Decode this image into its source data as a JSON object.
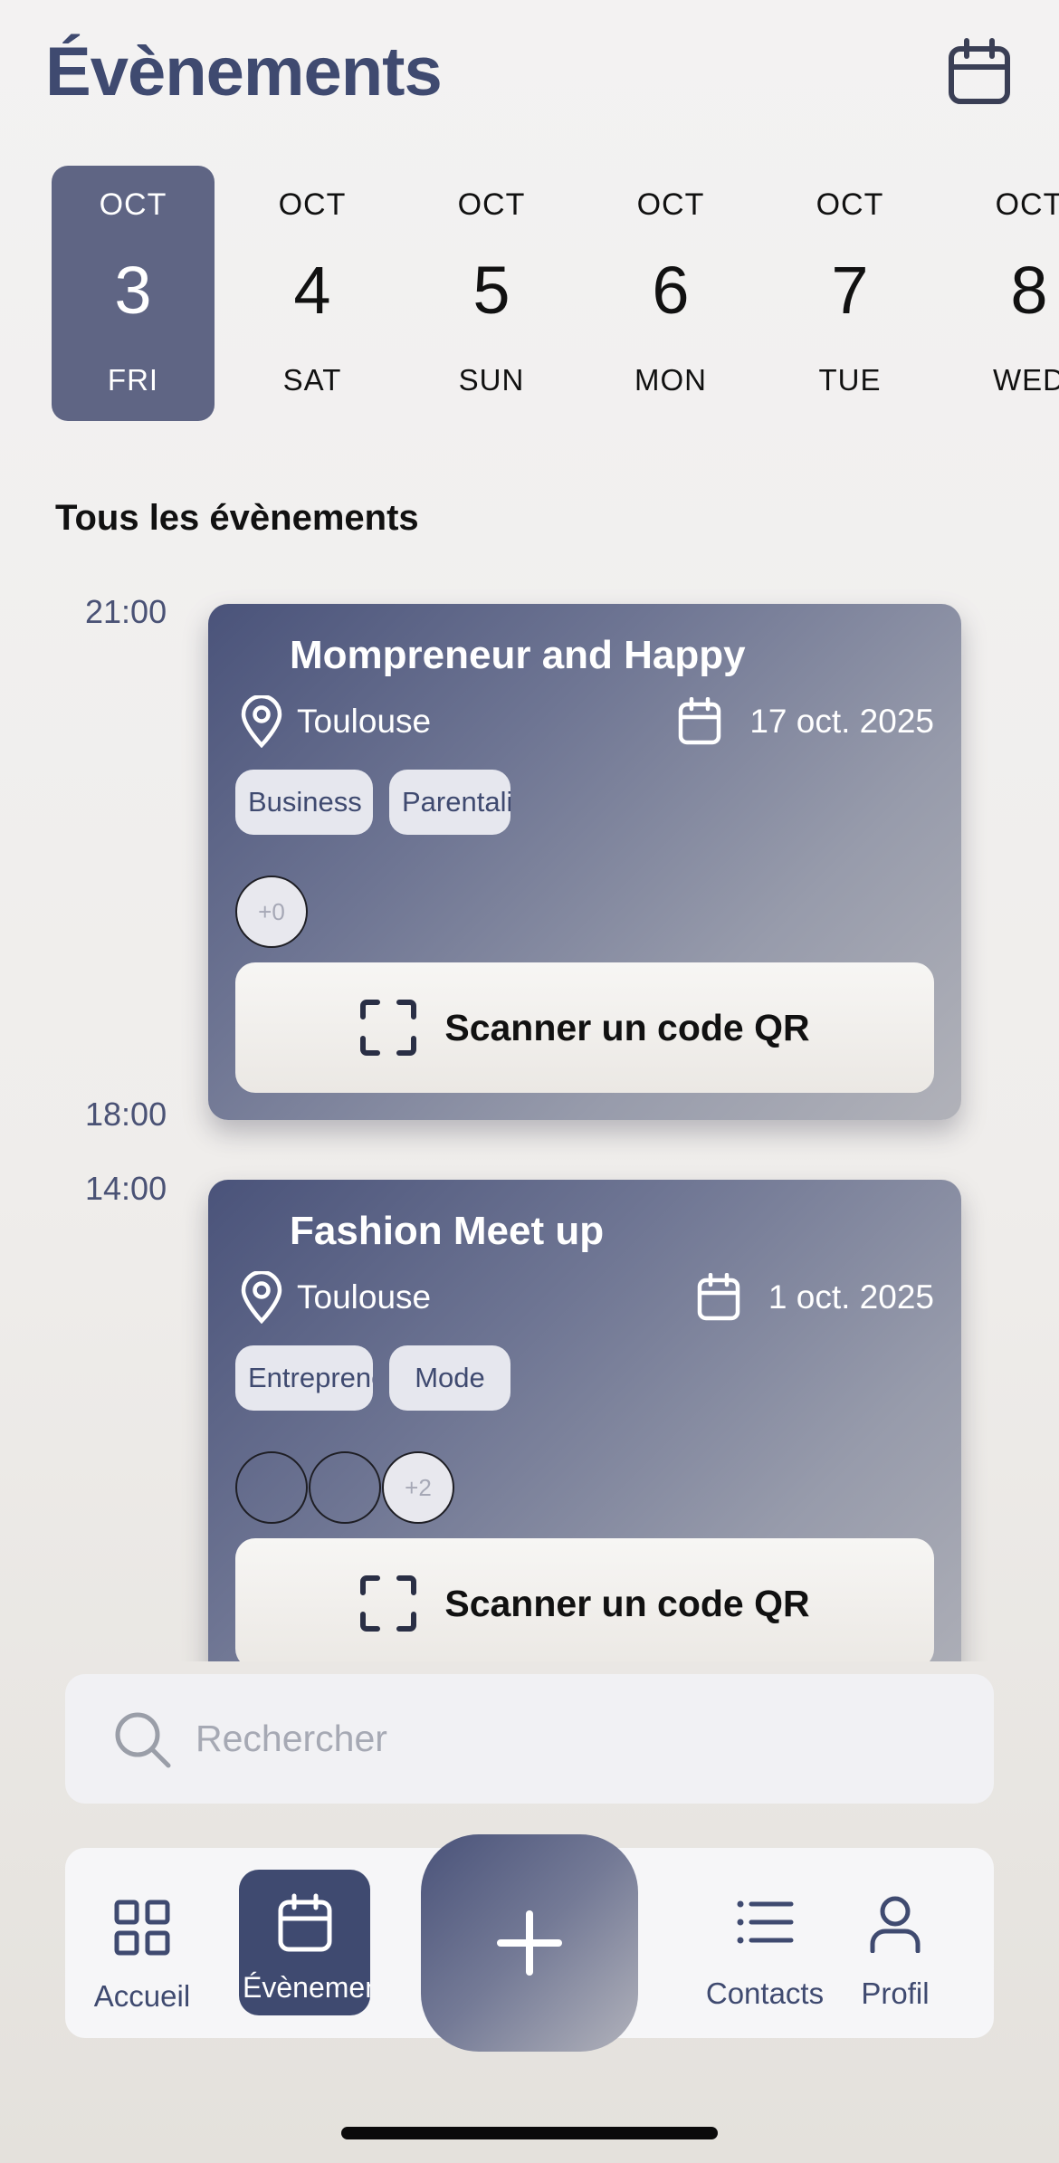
{
  "header": {
    "title": "Évènements",
    "calendar_icon": "calendar-icon"
  },
  "date_strip": [
    {
      "month": "OCT",
      "day": "3",
      "weekday": "FRI",
      "selected": true
    },
    {
      "month": "OCT",
      "day": "4",
      "weekday": "SAT",
      "selected": false
    },
    {
      "month": "OCT",
      "day": "5",
      "weekday": "SUN",
      "selected": false
    },
    {
      "month": "OCT",
      "day": "6",
      "weekday": "MON",
      "selected": false
    },
    {
      "month": "OCT",
      "day": "7",
      "weekday": "TUE",
      "selected": false
    },
    {
      "month": "OCT",
      "day": "8",
      "weekday": "WED",
      "selected": false
    }
  ],
  "section": {
    "title": "Tous les évènements"
  },
  "timeline": {
    "times": [
      "21:00",
      "18:00",
      "14:00"
    ],
    "events": [
      {
        "title": "Mompreneur and Happy",
        "location": "Toulouse",
        "date": "17 oct. 2025",
        "tags": [
          "Business",
          "Parentalité"
        ],
        "attendees_more": "+0",
        "scan_label": "Scanner un code QR"
      },
      {
        "title": "Fashion Meet up",
        "location": "Toulouse",
        "date": "1 oct. 2025",
        "tags": [
          "Entrepreneuriat",
          "Mode"
        ],
        "attendees_more": "+2",
        "scan_label": "Scanner un code QR"
      }
    ]
  },
  "search": {
    "placeholder": "Rechercher"
  },
  "nav": {
    "items": [
      {
        "label": "Accueil",
        "icon": "grid-icon"
      },
      {
        "label": "Évènements",
        "icon": "calendar-icon",
        "active": true
      },
      {
        "label": "",
        "icon": "plus-icon"
      },
      {
        "label": "Contacts",
        "icon": "list-icon"
      },
      {
        "label": "Profil",
        "icon": "user-icon"
      }
    ]
  },
  "colors": {
    "accent": "#3f4a70",
    "selected_date": "#5f6584"
  }
}
